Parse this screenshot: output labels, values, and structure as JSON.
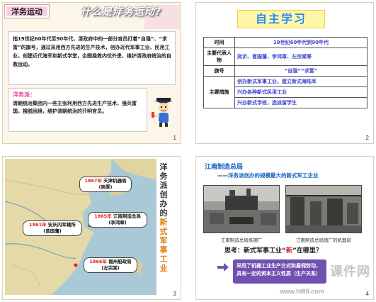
{
  "slides": [
    {
      "number": "1",
      "badge": "洋务运动",
      "title": "什么是洋务运动?",
      "intro": "指19世纪60年代至90年代，清政府中的一部分官员打着“自强”、“求富”的旗号，通过采用西方先进的生产技术，创办近代军事工业、民用工业，创建近代海军和新式学堂，企图挽救内忧外患、维护清政府统治的自救运动。",
      "faction_label": "洋务派：",
      "faction_text": "清朝统治集团内一些主张利用西方先进生产技术，强兵富国，摆脱困境，维护清朝统治的开明官员。"
    },
    {
      "number": "2",
      "title": "自主学习",
      "rows": [
        {
          "header": "时间",
          "values": [
            "19世纪60年代到90年代"
          ]
        },
        {
          "header": "主要代表人物",
          "values": [
            "奕䜣、曾国藩、李鸿章、左宗棠等"
          ]
        },
        {
          "header": "旗号",
          "values": [
            "“自强”“求富”"
          ]
        },
        {
          "header": "主要措施",
          "values": [
            "创办新式军事工业，建立新式海陆军",
            "兴办各种新式民用工业",
            "兴办新式学校，选派留学生"
          ]
        }
      ]
    },
    {
      "number": "3",
      "vertical_title_pre": "洋务派创办的",
      "vertical_title_em": "新式军事工业",
      "callouts": [
        {
          "year": "1867年",
          "name": "天津机器局",
          "founder": "(崇厚)"
        },
        {
          "year": "1865年",
          "name": "江南制造总局",
          "founder": "(李鸿章)"
        },
        {
          "year": "1861年",
          "name": "安庆内军械所",
          "founder": "(曾国藩)"
        },
        {
          "year": "1866年",
          "name": "福州船政局",
          "founder": "(左宗棠)"
        }
      ]
    },
    {
      "number": "4",
      "title": "江南制造总局",
      "subtitle_prefix": "——",
      "subtitle": "洋务派创办的规模最大的新式军工企业",
      "captions": [
        "江南制造总局炼钢厂",
        "江南制造总局炮厂的机器房"
      ],
      "question_pre": "思考：新式军事工业“",
      "question_em": "新",
      "question_post": "”在哪里？",
      "answer": "采用了机器工业生产方式和雇佣劳动，具有一定的资本主义性质（生产关系）",
      "watermark": "课件网",
      "watermark_url": "www.ht88.com"
    }
  ]
}
